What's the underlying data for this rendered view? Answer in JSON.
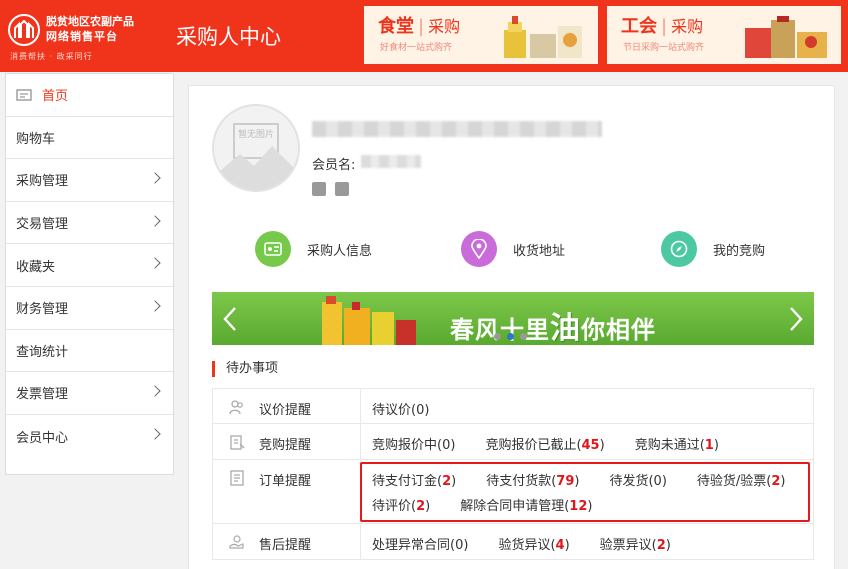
{
  "header": {
    "logo_line1": "脱贫地区农副产品",
    "logo_line2": "网络销售平台",
    "logo_line3": "消费帮扶 · 政采同行",
    "title": "采购人中心",
    "banners": [
      {
        "title": "食堂",
        "title2": "采购",
        "subtitle": "好食材一站式购齐"
      },
      {
        "title": "工会",
        "title2": "采购",
        "subtitle": "节日采购一站式购齐"
      }
    ]
  },
  "sidebar": {
    "items": [
      {
        "label": "首页",
        "active": true,
        "has_arrow": false,
        "icon": "home-icon"
      },
      {
        "label": "购物车",
        "has_arrow": false
      },
      {
        "label": "采购管理",
        "has_arrow": true
      },
      {
        "label": "交易管理",
        "has_arrow": true
      },
      {
        "label": "收藏夹",
        "has_arrow": true
      },
      {
        "label": "财务管理",
        "has_arrow": true
      },
      {
        "label": "查询统计",
        "has_arrow": false
      },
      {
        "label": "发票管理",
        "has_arrow": true
      },
      {
        "label": "会员中心",
        "has_arrow": true
      }
    ]
  },
  "profile": {
    "avatar_text": "暂无图片",
    "member_label": "会员名:"
  },
  "quick_links": [
    {
      "label": "采购人信息",
      "icon": "id-card-icon",
      "color": "#77c94b"
    },
    {
      "label": "收货地址",
      "icon": "location-pin-icon",
      "color": "#c96bd9"
    },
    {
      "label": "我的竞购",
      "icon": "compass-icon",
      "color": "#4cc9a3"
    }
  ],
  "promo": {
    "text_before": "春风十里",
    "text_highlight": "油",
    "text_after": "你相伴"
  },
  "todo": {
    "title": "待办事项",
    "rows": [
      {
        "label": "议价提醒",
        "icon": "people-icon",
        "items": [
          {
            "text": "待议价(",
            "count": "0",
            "suffix": ")",
            "highlight": false
          }
        ]
      },
      {
        "label": "竞购提醒",
        "icon": "bid-icon",
        "items": [
          {
            "text": "竞购报价中(",
            "count": "0",
            "suffix": ")",
            "highlight": false
          },
          {
            "text": "竞购报价已截止(",
            "count": "45",
            "suffix": ")",
            "highlight": true
          },
          {
            "text": "竞购未通过(",
            "count": "1",
            "suffix": ")",
            "highlight": true
          }
        ]
      },
      {
        "label": "订单提醒",
        "icon": "order-icon",
        "items": [
          {
            "text": "待支付订金(",
            "count": "2",
            "suffix": ")",
            "highlight": true
          },
          {
            "text": "待支付货款(",
            "count": "79",
            "suffix": ")",
            "highlight": true
          },
          {
            "text": "待发货(",
            "count": "0",
            "suffix": ")",
            "highlight": false
          },
          {
            "text": "待验货/验票(",
            "count": "2",
            "suffix": ")",
            "highlight": true
          }
        ],
        "items2": [
          {
            "text": "待评价(",
            "count": "2",
            "suffix": ")",
            "highlight": true
          },
          {
            "text": "解除合同申请管理(",
            "count": "12",
            "suffix": ")",
            "highlight": true
          }
        ]
      },
      {
        "label": "售后提醒",
        "icon": "aftersale-icon",
        "items": [
          {
            "text": "处理异常合同(",
            "count": "0",
            "suffix": ")",
            "highlight": false
          },
          {
            "text": "验货异议(",
            "count": "4",
            "suffix": ")",
            "highlight": true
          },
          {
            "text": "验票异议(",
            "count": "2",
            "suffix": ")",
            "highlight": true
          }
        ]
      }
    ]
  },
  "colors": {
    "brand": "#f0341c",
    "highlight": "#e0161b"
  }
}
